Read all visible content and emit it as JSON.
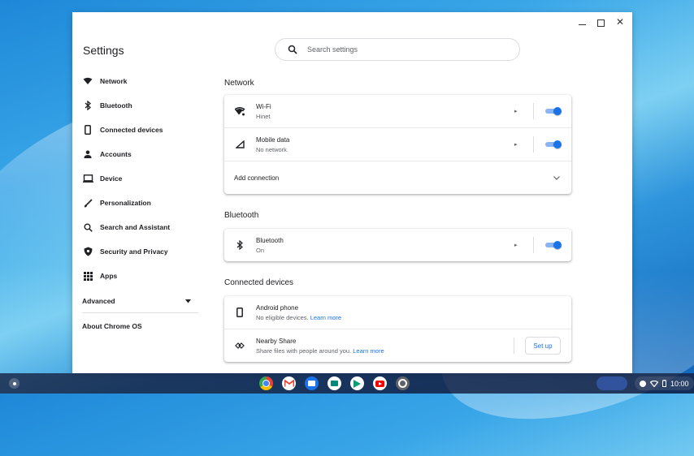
{
  "app": {
    "title": "Settings"
  },
  "search": {
    "placeholder": "Search settings"
  },
  "sidebar": {
    "items": [
      {
        "label": "Network",
        "icon": "wifi-icon"
      },
      {
        "label": "Bluetooth",
        "icon": "bluetooth-icon"
      },
      {
        "label": "Connected devices",
        "icon": "phone-icon"
      },
      {
        "label": "Accounts",
        "icon": "person-icon"
      },
      {
        "label": "Device",
        "icon": "laptop-icon"
      },
      {
        "label": "Personalization",
        "icon": "brush-icon"
      },
      {
        "label": "Search and Assistant",
        "icon": "search-icon"
      },
      {
        "label": "Security and Privacy",
        "icon": "shield-icon"
      },
      {
        "label": "Apps",
        "icon": "grid-icon"
      }
    ],
    "advanced": "Advanced",
    "about": "About Chrome OS"
  },
  "network": {
    "title": "Network",
    "wifi": {
      "label": "Wi-Fi",
      "status": "Hinet",
      "enabled": true
    },
    "mobile": {
      "label": "Mobile data",
      "status": "No network",
      "enabled": true
    },
    "add": "Add connection"
  },
  "bluetooth": {
    "title": "Bluetooth",
    "row": {
      "label": "Bluetooth",
      "status": "On",
      "enabled": true
    }
  },
  "connected": {
    "title": "Connected devices",
    "android": {
      "label": "Android phone",
      "status": "No eligible devices.",
      "link": "Learn more"
    },
    "nearby": {
      "label": "Nearby Share",
      "status": "Share files with people around you.",
      "link": "Learn more",
      "button": "Set up"
    }
  },
  "shelf": {
    "apps": [
      "chrome-icon",
      "gmail-icon",
      "files-icon",
      "meet-icon",
      "play-store-icon",
      "youtube-icon",
      "settings-icon"
    ],
    "time": "10:00"
  },
  "colors": {
    "accent": "#1a73e8",
    "toggle_track": "#8ab4f8"
  }
}
